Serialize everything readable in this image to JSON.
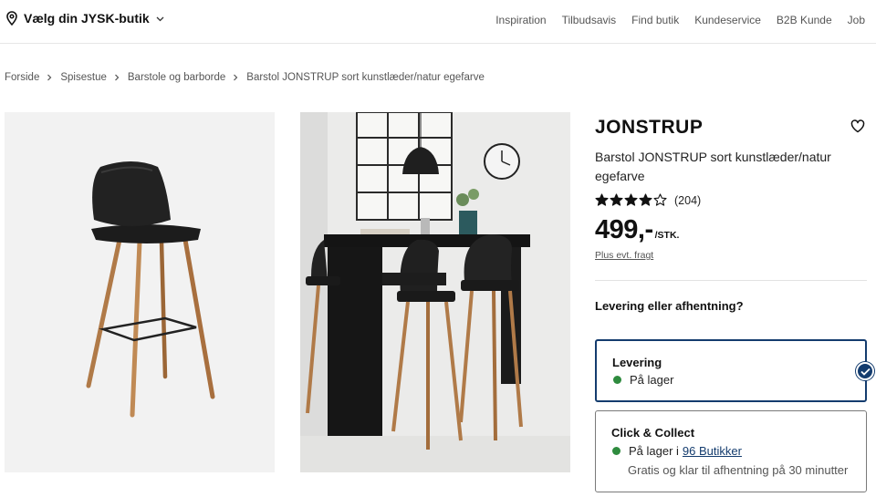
{
  "header": {
    "store_select_label": "Vælg din JYSK-butik",
    "nav": [
      "Inspiration",
      "Tilbudsavis",
      "Find butik",
      "Kundeservice",
      "B2B Kunde",
      "Job"
    ]
  },
  "breadcrumb": [
    "Forside",
    "Spisestue",
    "Barstole og barborde",
    "Barstol JONSTRUP sort kunstlæder/natur egefarve"
  ],
  "product": {
    "brand": "JONSTRUP",
    "description": "Barstol JONSTRUP sort kunstlæder/natur egefarve",
    "rating": 4,
    "rating_max": 5,
    "review_count": "(204)",
    "price": "499,-",
    "unit": "/STK.",
    "freight_link": "Plus evt. fragt"
  },
  "fulfilment": {
    "question": "Levering eller afhentning?",
    "delivery": {
      "title": "Levering",
      "stock_text": "På lager",
      "selected": true
    },
    "collect": {
      "title": "Click & Collect",
      "stock_text": "På lager i",
      "stores_link": "96 Butikker",
      "note": "Gratis og klar til afhentning på 30 minutter"
    }
  },
  "colors": {
    "accent_navy": "#143c6e",
    "in_stock_green": "#2e8b3e",
    "chair_leather": "#1c1c1c",
    "chair_wood": "#b07a48"
  },
  "icons": [
    "location-pin-icon",
    "chevron-down-icon",
    "chevron-right-icon",
    "heart-icon",
    "star-icon",
    "checkmark-icon"
  ]
}
